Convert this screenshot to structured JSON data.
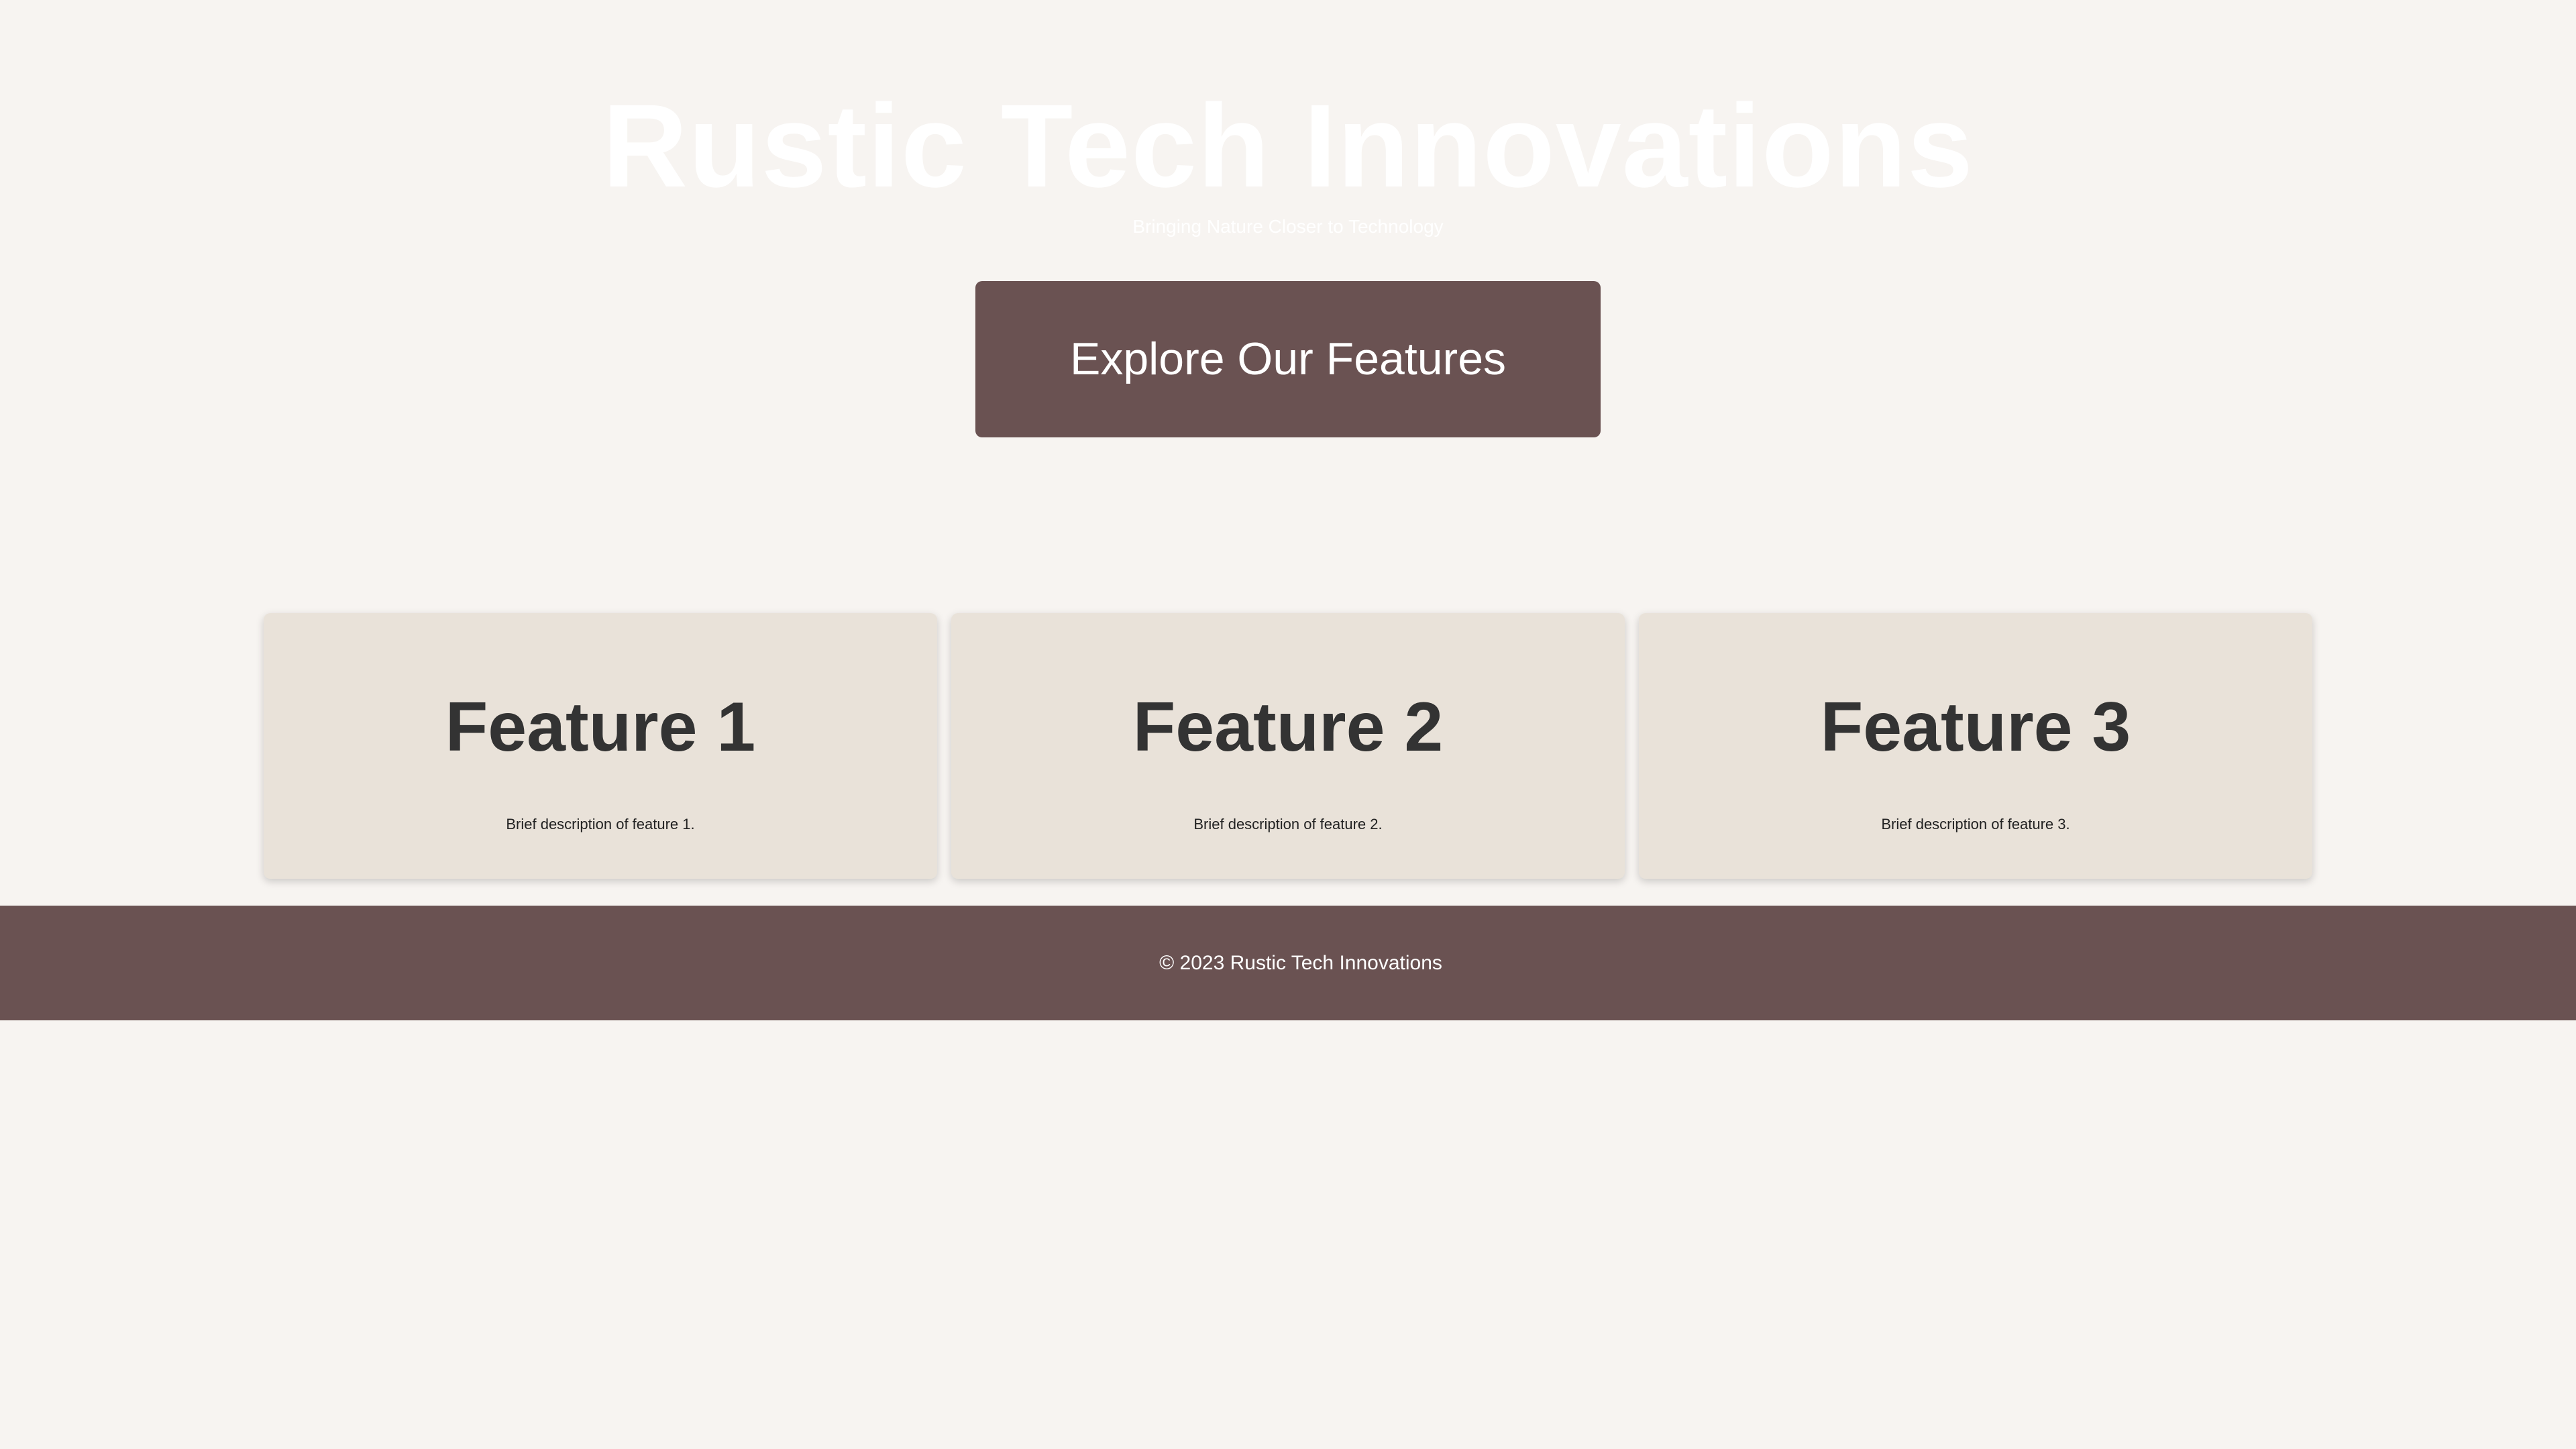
{
  "hero": {
    "title": "Rustic Tech Innovations",
    "tagline": "Bringing Nature Closer to Technology",
    "cta_label": "Explore Our Features"
  },
  "features": [
    {
      "title": "Feature 1",
      "description": "Brief description of feature 1."
    },
    {
      "title": "Feature 2",
      "description": "Brief description of feature 2."
    },
    {
      "title": "Feature 3",
      "description": "Brief description of feature 3."
    }
  ],
  "footer": {
    "text": "© 2023 Rustic Tech Innovations"
  },
  "colors": {
    "background": "#f7f4f1",
    "accent": "#6a5252",
    "card": "#e9e2d9",
    "heading": "#333333"
  }
}
